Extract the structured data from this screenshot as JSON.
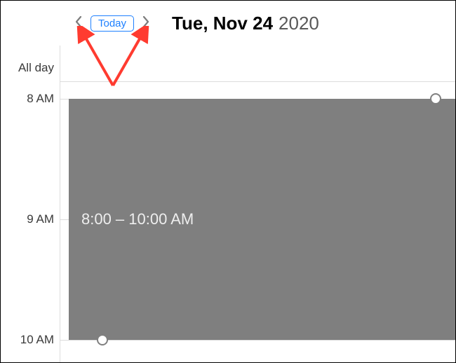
{
  "header": {
    "today_label": "Today",
    "date_day": "Tue, Nov 24",
    "date_year": "2020"
  },
  "gutter": {
    "allday": "All day",
    "h8": "8 AM",
    "h9": "9 AM",
    "h10": "10 AM"
  },
  "event": {
    "time_label": "8:00 – 10:00 AM"
  }
}
